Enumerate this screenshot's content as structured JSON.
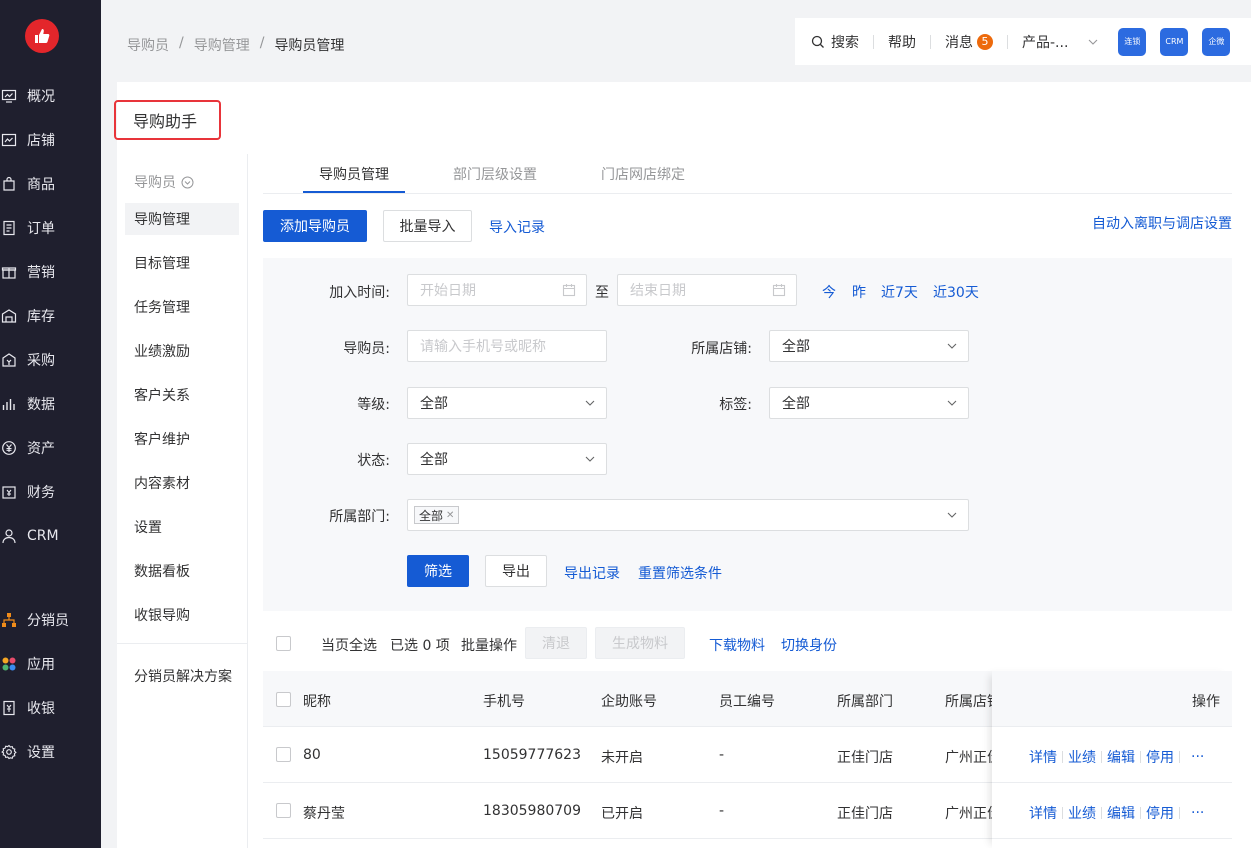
{
  "sidebar": {
    "logo_icon": "thumbs-up-icon",
    "items": [
      {
        "label": "概况",
        "icon": "monitor-icon"
      },
      {
        "label": "店铺",
        "icon": "store-icon"
      },
      {
        "label": "商品",
        "icon": "bag-icon"
      },
      {
        "label": "订单",
        "icon": "order-icon"
      },
      {
        "label": "营销",
        "icon": "gift-icon"
      },
      {
        "label": "库存",
        "icon": "warehouse-icon"
      },
      {
        "label": "采购",
        "icon": "purchase-icon"
      },
      {
        "label": "数据",
        "icon": "bar-chart-icon"
      },
      {
        "label": "资产",
        "icon": "yuan-circle-icon"
      },
      {
        "label": "财务",
        "icon": "wallet-icon"
      },
      {
        "label": "CRM",
        "icon": "user-icon"
      },
      {
        "label": "分销员",
        "icon": "network-icon"
      },
      {
        "label": "应用",
        "icon": "apps-icon"
      },
      {
        "label": "收银",
        "icon": "cashier-icon"
      },
      {
        "label": "设置",
        "icon": "gear-icon"
      }
    ]
  },
  "breadcrumb": {
    "items": [
      "导购员",
      "导购管理",
      "导购员管理"
    ],
    "sep": "/"
  },
  "topbar": {
    "search": "搜索",
    "help": "帮助",
    "messages": "消息",
    "message_count": "5",
    "product": "产品-...",
    "apps": [
      "连锁",
      "CRM",
      "企微"
    ]
  },
  "page_title": "导购助手",
  "subnav": {
    "group": "导购员",
    "items": [
      "导购管理",
      "目标管理",
      "任务管理",
      "业绩激励",
      "客户关系",
      "客户维护",
      "内容素材",
      "设置",
      "数据看板",
      "收银导购"
    ],
    "extra": "分销员解决方案"
  },
  "tabs": [
    "导购员管理",
    "部门层级设置",
    "门店网店绑定"
  ],
  "actions": {
    "add": "添加导购员",
    "batch_import": "批量导入",
    "import_records": "导入记录",
    "auto_settings": "自动入离职与调店设置"
  },
  "filter": {
    "join_time_label": "加入时间:",
    "start_placeholder": "开始日期",
    "to": "至",
    "end_placeholder": "结束日期",
    "quick": [
      "今",
      "昨",
      "近7天",
      "近30天"
    ],
    "guide_label": "导购员:",
    "guide_placeholder": "请输入手机号或昵称",
    "store_label": "所属店铺:",
    "store_value": "全部",
    "level_label": "等级:",
    "level_value": "全部",
    "tag_label": "标签:",
    "tag_value": "全部",
    "status_label": "状态:",
    "status_value": "全部",
    "dept_label": "所属部门:",
    "dept_tag": "全部",
    "filter_btn": "筛选",
    "export_btn": "导出",
    "export_records": "导出记录",
    "reset": "重置筛选条件"
  },
  "bulk": {
    "select_all": "当页全选",
    "selected": "已选 0 项",
    "batch": "批量操作",
    "resign": "清退",
    "gen_material": "生成物料",
    "download": "下载物料",
    "switch_role": "切换身份"
  },
  "table": {
    "columns": [
      "昵称",
      "手机号",
      "企助账号",
      "员工编号",
      "所属部门",
      "所属店铺",
      "操作"
    ],
    "rows": [
      {
        "nickname": "80",
        "phone": "15059777623",
        "account": "未开启",
        "emp_no": "-",
        "dept": "正佳门店",
        "store": "广州正佳"
      },
      {
        "nickname": "蔡丹莹",
        "phone": "18305980709",
        "account": "已开启",
        "emp_no": "-",
        "dept": "正佳门店",
        "store": "广州正佳"
      }
    ],
    "ops": [
      "详情",
      "业绩",
      "编辑",
      "停用",
      "···"
    ]
  }
}
